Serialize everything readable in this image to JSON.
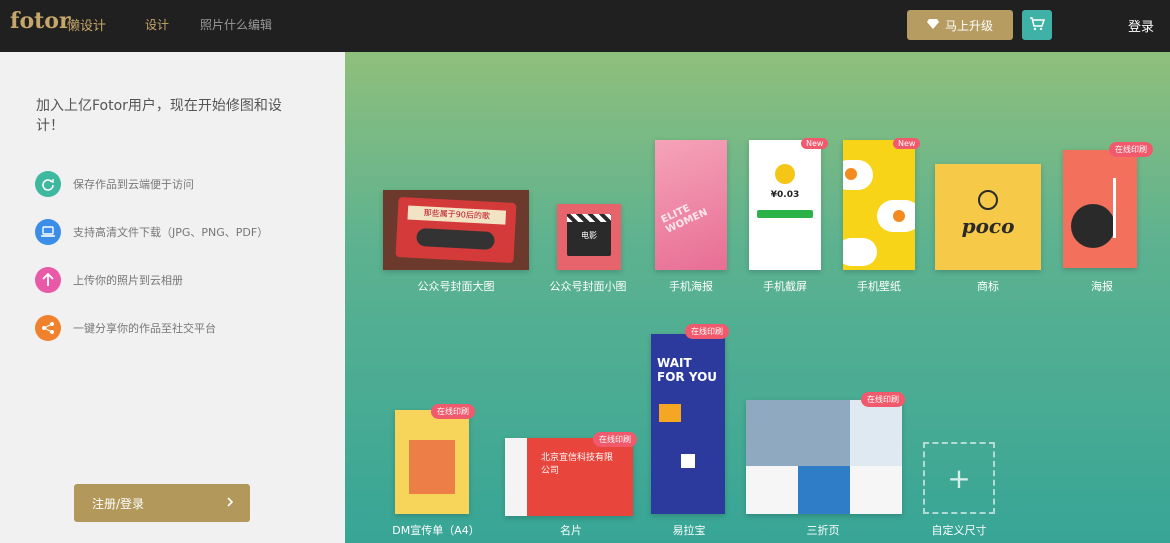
{
  "header": {
    "logo": "fotor",
    "logo_sub": "懒设计",
    "nav": [
      {
        "label": "设计",
        "active": true
      },
      {
        "label": "照片什么编辑",
        "active": false
      }
    ],
    "upgrade_label": "马上升级",
    "login_label": "登录"
  },
  "sidebar": {
    "intro": "加入上亿Fotor用户，现在开始修图和设计！",
    "features": [
      {
        "text": "保存作品到云端便于访问",
        "icon": "sync-icon",
        "color": "#3fb8a0"
      },
      {
        "text": "支持高清文件下载（JPG、PNG、PDF）",
        "icon": "laptop-icon",
        "color": "#3a8ee8"
      },
      {
        "text": "上传你的照片到云相册",
        "icon": "upload-icon",
        "color": "#e85aa8"
      },
      {
        "text": "一键分享你的作品至社交平台",
        "icon": "share-icon",
        "color": "#f0822e"
      }
    ],
    "register_label": "注册/登录"
  },
  "templates": {
    "row1": [
      {
        "label": "公众号封面大图",
        "thumb_text": "那些属于90后的歌"
      },
      {
        "label": "公众号封面小图",
        "thumb_text": "电影"
      },
      {
        "label": "手机海报",
        "thumb_text": "ELITE WOMEN"
      },
      {
        "label": "手机截屏",
        "thumb_text": "¥0.03",
        "badge": "New"
      },
      {
        "label": "手机壁纸",
        "badge": "New"
      },
      {
        "label": "商标",
        "thumb_text": "poco"
      },
      {
        "label": "海报",
        "badge": "在线印刷"
      }
    ],
    "row2": [
      {
        "label": "DM宣传单（A4）",
        "badge": "在线印刷"
      },
      {
        "label": "名片",
        "badge": "在线印刷",
        "thumb_text": "北京宜信科技有限公司"
      },
      {
        "label": "易拉宝",
        "badge": "在线印刷",
        "thumb_text": "WAIT FOR YOU"
      },
      {
        "label": "三折页",
        "badge": "在线印刷"
      },
      {
        "label": "自定义尺寸"
      }
    ]
  },
  "colors": {
    "brand_gold": "#c6a66a",
    "topbar_bg": "#202020",
    "cart_teal": "#3fb1a7",
    "badge_red": "#f05a6c"
  }
}
